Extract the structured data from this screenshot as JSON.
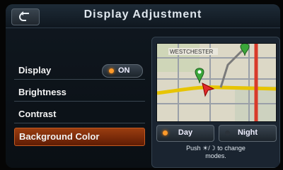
{
  "header": {
    "title": "Display Adjustment"
  },
  "menu": {
    "items": [
      {
        "label": "Display"
      },
      {
        "label": "Brightness"
      },
      {
        "label": "Contrast"
      },
      {
        "label": "Background Color"
      }
    ],
    "display_toggle": {
      "label": "ON",
      "state": "on"
    }
  },
  "preview": {
    "map_label": "WESTCHESTER",
    "modes": [
      {
        "label": "Day",
        "selected": true
      },
      {
        "label": "Night",
        "selected": false
      }
    ],
    "hint_line1": "Push ☀/☽ to change",
    "hint_line2": "modes."
  },
  "colors": {
    "accent": "#ff9a2a",
    "selected_bg": "#8a3410",
    "title_text": "#dfe7ee"
  },
  "icons": {
    "back": "back-arrow-icon",
    "route_marker": "map-marker-icon",
    "position": "vehicle-arrow-icon"
  }
}
